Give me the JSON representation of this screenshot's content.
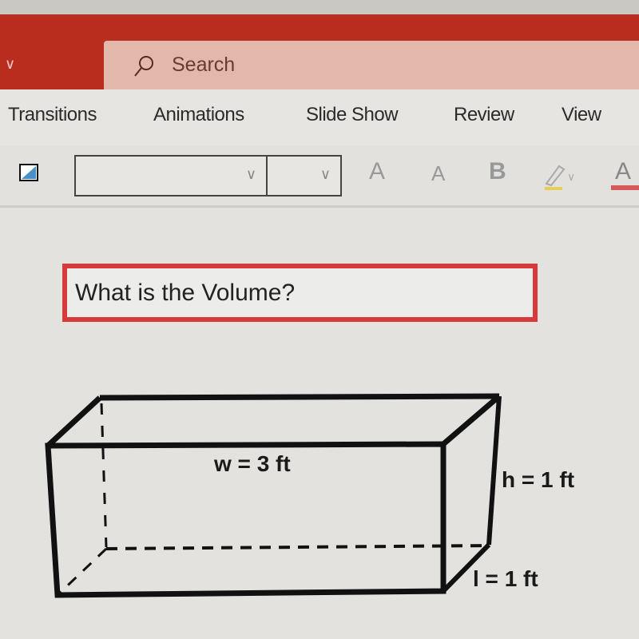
{
  "titlebar": {
    "search_placeholder": "Search",
    "accent": "#b92d1e"
  },
  "ribbon": {
    "tabs": [
      "Transitions",
      "Animations",
      "Slide Show",
      "Review",
      "View"
    ]
  },
  "toolbar": {
    "font_name": "",
    "font_size": "",
    "grow_font": "A",
    "shrink_font": "A",
    "bold": "B",
    "font_color": "A"
  },
  "slide": {
    "question": "What is the Volume?",
    "labels": {
      "width": "w = 3 ft",
      "height": "h = 1 ft",
      "length": "l = 1 ft"
    }
  }
}
